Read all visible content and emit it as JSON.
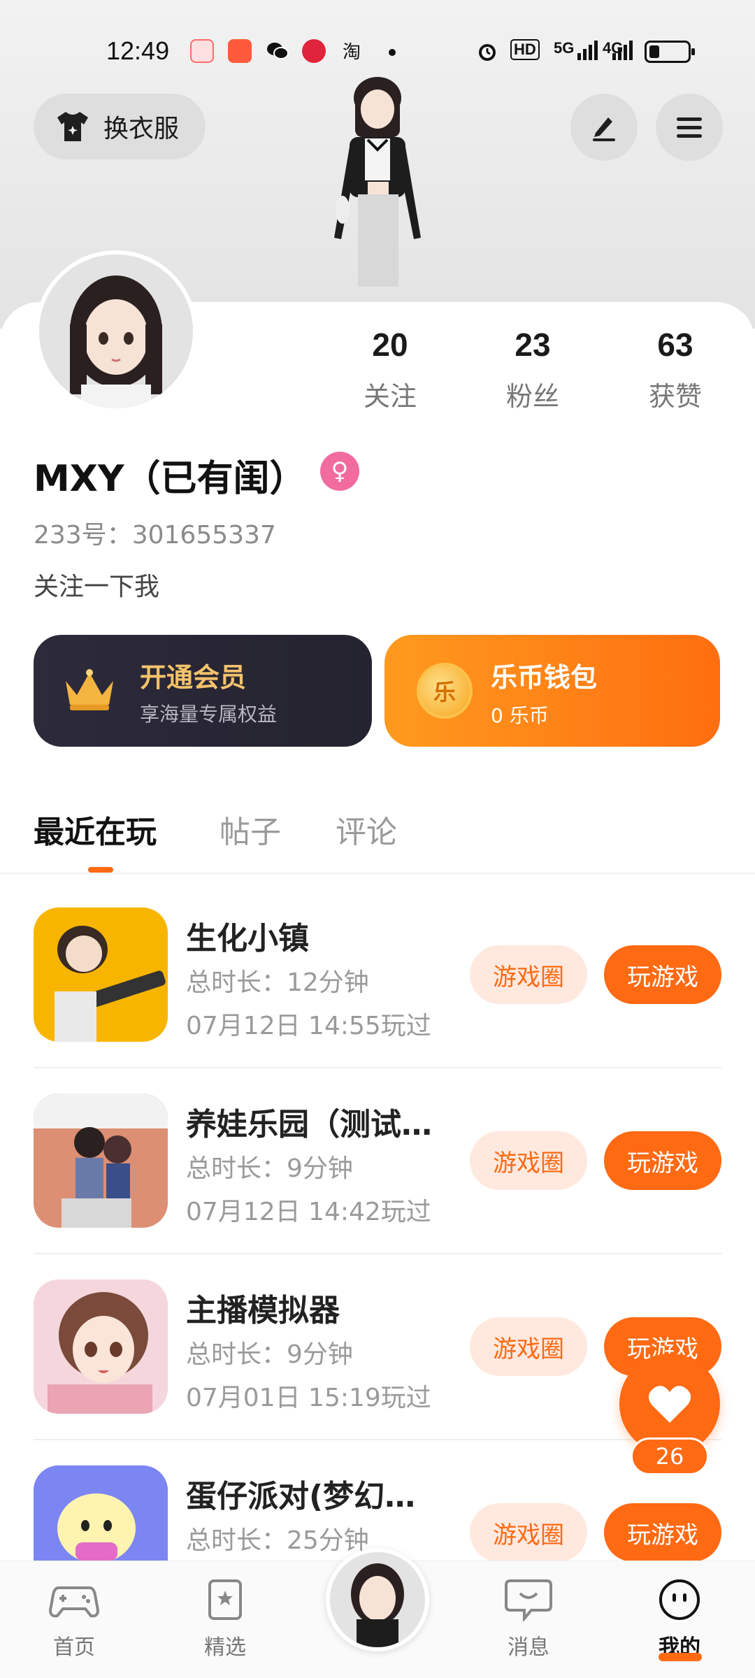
{
  "status_bar": {
    "time": "12:49",
    "net1": "HD",
    "net2": "5G",
    "net3": "4G"
  },
  "header": {
    "outfit_label": "换衣服",
    "edit_icon": "pen-icon",
    "menu_icon": "menu-icon"
  },
  "profile": {
    "following_count": "20",
    "following_label": "关注",
    "followers_count": "23",
    "followers_label": "粉丝",
    "likes_count": "63",
    "likes_label": "获赞",
    "name": "MXY（已有闺）",
    "uid": "233号：301655337",
    "bio": "关注一下我"
  },
  "vip": {
    "title": "开通会员",
    "subtitle": "享海量专属权益"
  },
  "wallet": {
    "title": "乐币钱包",
    "subtitle": "0 乐币",
    "coin_glyph": "乐"
  },
  "tabs": [
    {
      "label": "最近在玩"
    },
    {
      "label": "帖子"
    },
    {
      "label": "评论"
    }
  ],
  "games": [
    {
      "name": "生化小镇",
      "duration": "总时长：12分钟",
      "last_played": "07月12日 14:55玩过",
      "circle_label": "游戏圈",
      "play_label": "玩游戏"
    },
    {
      "name": "养娃乐园（测试…",
      "duration": "总时长：9分钟",
      "last_played": "07月12日 14:42玩过",
      "circle_label": "游戏圈",
      "play_label": "玩游戏"
    },
    {
      "name": "主播模拟器",
      "duration": "总时长：9分钟",
      "last_played": "07月01日 15:19玩过",
      "circle_label": "游戏圈",
      "play_label": "玩游戏"
    },
    {
      "name": "蛋仔派对(梦幻…",
      "duration": "总时长：25分钟",
      "last_played": "",
      "circle_label": "游戏圈",
      "play_label": "玩游戏"
    }
  ],
  "like_button": {
    "count": "26"
  },
  "nav": [
    {
      "label": "首页",
      "icon": "gamepad-icon"
    },
    {
      "label": "精选",
      "icon": "star-card-icon"
    },
    {
      "label": "消息",
      "icon": "chat-icon"
    },
    {
      "label": "我的",
      "icon": "smile-face-icon"
    }
  ],
  "colors": {
    "accent": "#ff6a13",
    "vip_bg": "#2d2a3a",
    "vip_gold": "#f3c26b"
  }
}
